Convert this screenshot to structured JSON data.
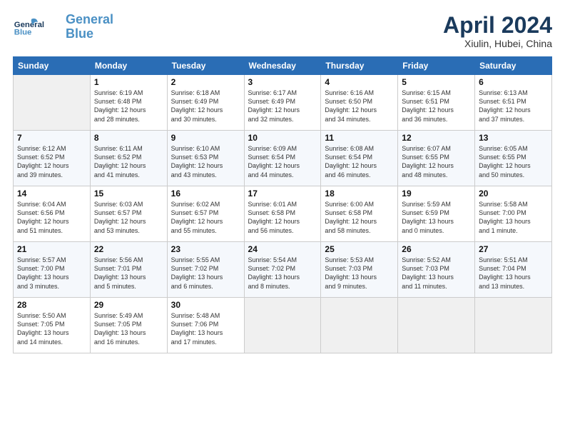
{
  "header": {
    "logo_line1": "General",
    "logo_line2": "Blue",
    "month_title": "April 2024",
    "location": "Xiulin, Hubei, China"
  },
  "weekdays": [
    "Sunday",
    "Monday",
    "Tuesday",
    "Wednesday",
    "Thursday",
    "Friday",
    "Saturday"
  ],
  "weeks": [
    [
      {
        "day": "",
        "text": ""
      },
      {
        "day": "1",
        "text": "Sunrise: 6:19 AM\nSunset: 6:48 PM\nDaylight: 12 hours\nand 28 minutes."
      },
      {
        "day": "2",
        "text": "Sunrise: 6:18 AM\nSunset: 6:49 PM\nDaylight: 12 hours\nand 30 minutes."
      },
      {
        "day": "3",
        "text": "Sunrise: 6:17 AM\nSunset: 6:49 PM\nDaylight: 12 hours\nand 32 minutes."
      },
      {
        "day": "4",
        "text": "Sunrise: 6:16 AM\nSunset: 6:50 PM\nDaylight: 12 hours\nand 34 minutes."
      },
      {
        "day": "5",
        "text": "Sunrise: 6:15 AM\nSunset: 6:51 PM\nDaylight: 12 hours\nand 36 minutes."
      },
      {
        "day": "6",
        "text": "Sunrise: 6:13 AM\nSunset: 6:51 PM\nDaylight: 12 hours\nand 37 minutes."
      }
    ],
    [
      {
        "day": "7",
        "text": "Sunrise: 6:12 AM\nSunset: 6:52 PM\nDaylight: 12 hours\nand 39 minutes."
      },
      {
        "day": "8",
        "text": "Sunrise: 6:11 AM\nSunset: 6:52 PM\nDaylight: 12 hours\nand 41 minutes."
      },
      {
        "day": "9",
        "text": "Sunrise: 6:10 AM\nSunset: 6:53 PM\nDaylight: 12 hours\nand 43 minutes."
      },
      {
        "day": "10",
        "text": "Sunrise: 6:09 AM\nSunset: 6:54 PM\nDaylight: 12 hours\nand 44 minutes."
      },
      {
        "day": "11",
        "text": "Sunrise: 6:08 AM\nSunset: 6:54 PM\nDaylight: 12 hours\nand 46 minutes."
      },
      {
        "day": "12",
        "text": "Sunrise: 6:07 AM\nSunset: 6:55 PM\nDaylight: 12 hours\nand 48 minutes."
      },
      {
        "day": "13",
        "text": "Sunrise: 6:05 AM\nSunset: 6:55 PM\nDaylight: 12 hours\nand 50 minutes."
      }
    ],
    [
      {
        "day": "14",
        "text": "Sunrise: 6:04 AM\nSunset: 6:56 PM\nDaylight: 12 hours\nand 51 minutes."
      },
      {
        "day": "15",
        "text": "Sunrise: 6:03 AM\nSunset: 6:57 PM\nDaylight: 12 hours\nand 53 minutes."
      },
      {
        "day": "16",
        "text": "Sunrise: 6:02 AM\nSunset: 6:57 PM\nDaylight: 12 hours\nand 55 minutes."
      },
      {
        "day": "17",
        "text": "Sunrise: 6:01 AM\nSunset: 6:58 PM\nDaylight: 12 hours\nand 56 minutes."
      },
      {
        "day": "18",
        "text": "Sunrise: 6:00 AM\nSunset: 6:58 PM\nDaylight: 12 hours\nand 58 minutes."
      },
      {
        "day": "19",
        "text": "Sunrise: 5:59 AM\nSunset: 6:59 PM\nDaylight: 13 hours\nand 0 minutes."
      },
      {
        "day": "20",
        "text": "Sunrise: 5:58 AM\nSunset: 7:00 PM\nDaylight: 13 hours\nand 1 minute."
      }
    ],
    [
      {
        "day": "21",
        "text": "Sunrise: 5:57 AM\nSunset: 7:00 PM\nDaylight: 13 hours\nand 3 minutes."
      },
      {
        "day": "22",
        "text": "Sunrise: 5:56 AM\nSunset: 7:01 PM\nDaylight: 13 hours\nand 5 minutes."
      },
      {
        "day": "23",
        "text": "Sunrise: 5:55 AM\nSunset: 7:02 PM\nDaylight: 13 hours\nand 6 minutes."
      },
      {
        "day": "24",
        "text": "Sunrise: 5:54 AM\nSunset: 7:02 PM\nDaylight: 13 hours\nand 8 minutes."
      },
      {
        "day": "25",
        "text": "Sunrise: 5:53 AM\nSunset: 7:03 PM\nDaylight: 13 hours\nand 9 minutes."
      },
      {
        "day": "26",
        "text": "Sunrise: 5:52 AM\nSunset: 7:03 PM\nDaylight: 13 hours\nand 11 minutes."
      },
      {
        "day": "27",
        "text": "Sunrise: 5:51 AM\nSunset: 7:04 PM\nDaylight: 13 hours\nand 13 minutes."
      }
    ],
    [
      {
        "day": "28",
        "text": "Sunrise: 5:50 AM\nSunset: 7:05 PM\nDaylight: 13 hours\nand 14 minutes."
      },
      {
        "day": "29",
        "text": "Sunrise: 5:49 AM\nSunset: 7:05 PM\nDaylight: 13 hours\nand 16 minutes."
      },
      {
        "day": "30",
        "text": "Sunrise: 5:48 AM\nSunset: 7:06 PM\nDaylight: 13 hours\nand 17 minutes."
      },
      {
        "day": "",
        "text": ""
      },
      {
        "day": "",
        "text": ""
      },
      {
        "day": "",
        "text": ""
      },
      {
        "day": "",
        "text": ""
      }
    ]
  ]
}
